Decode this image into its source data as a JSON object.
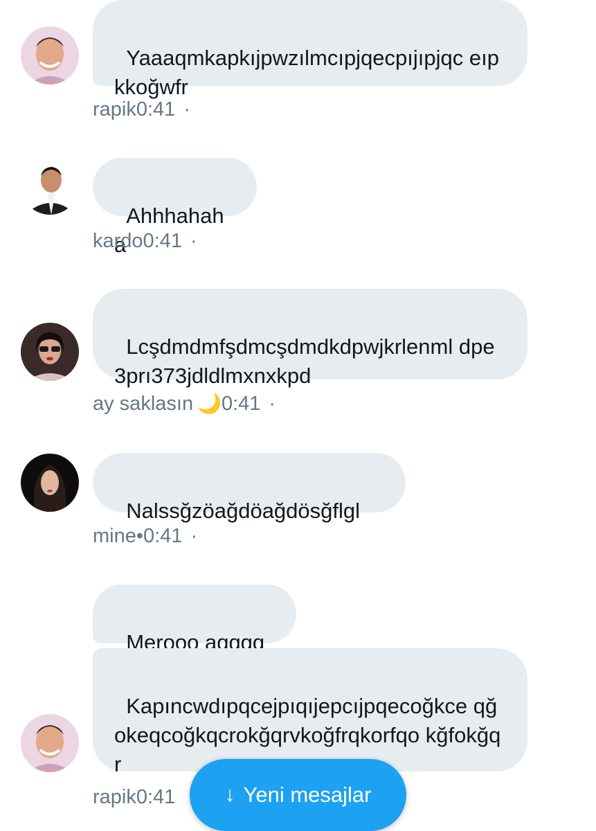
{
  "messages": [
    {
      "text": "Yaaaqmkapkıjpwzılmcıpjqecpıjıpjqc eıpkkoğwfr",
      "meta": "rapik0:41",
      "avatar_icon": "user-avatar-rapik"
    },
    {
      "text": "Ahhhahaha",
      "meta": "kardo0:41",
      "avatar_icon": "user-avatar-kardo"
    },
    {
      "text": "Lcşdmdmfşdmcşdmdkdpwjkrlenml dpe3prı373jdldlmxnxkpd",
      "meta_name": "ay saklasın",
      "meta_emoji": "🌙",
      "meta_time": "0:41",
      "avatar_icon": "user-avatar-ay-saklasin"
    },
    {
      "text": "Nalssğzöağdöağdösğflgl",
      "meta": "mine•0:41",
      "avatar_icon": "user-avatar-mine"
    },
    {
      "text": "Merooo aqqqq",
      "avatar_icon": ""
    },
    {
      "text": "Kapıncwdıpqcejpıqıjepcıjpqecoğkce qğokeqcoğkqcrokğqrvkoğfrqkorfqo kğfokğqr",
      "meta": "rapik0:41",
      "avatar_icon": "user-avatar-rapik"
    }
  ],
  "meta_separator": "·",
  "new_messages_button": {
    "label": "Yeni mesajlar",
    "icon": "arrow-down-icon",
    "arrow_glyph": "↓"
  },
  "colors": {
    "bubble": "#e6ecf0",
    "meta_text": "#657786",
    "accent": "#1da1f2"
  }
}
